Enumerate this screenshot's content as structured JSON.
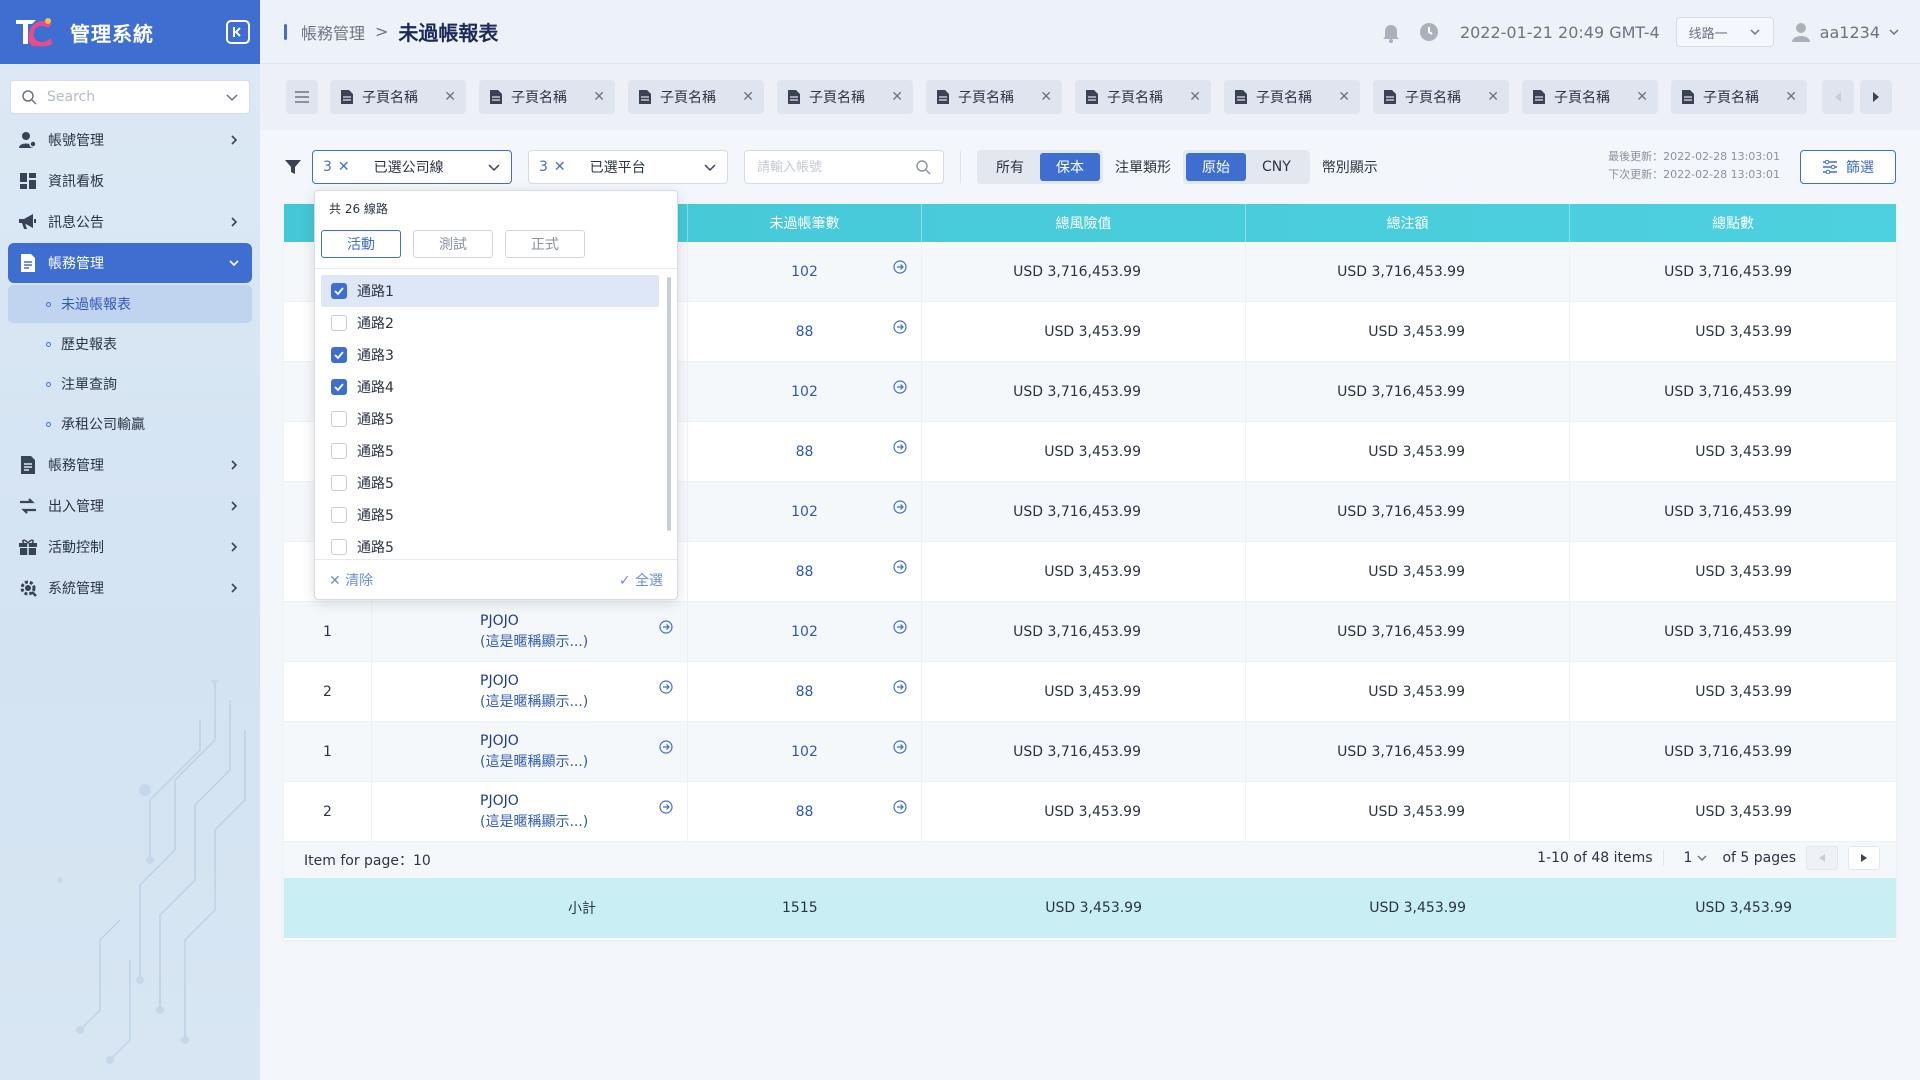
{
  "app": {
    "title": "管理系統"
  },
  "sidebar": {
    "search_placeholder": "Search",
    "items": [
      {
        "label": "帳號管理",
        "icon": "user-gear-icon",
        "has_arrow": true
      },
      {
        "label": "資訊看板",
        "icon": "dashboard-icon",
        "has_arrow": false
      },
      {
        "label": "訊息公告",
        "icon": "megaphone-icon",
        "has_arrow": true
      },
      {
        "label": "帳務管理",
        "icon": "document-icon",
        "has_arrow": true,
        "active": true
      },
      {
        "label": "帳務管理",
        "icon": "report-icon",
        "has_arrow": true
      },
      {
        "label": "出入管理",
        "icon": "transfer-icon",
        "has_arrow": true
      },
      {
        "label": "活動控制",
        "icon": "gift-icon",
        "has_arrow": true
      },
      {
        "label": "系統管理",
        "icon": "settings-icon",
        "has_arrow": true
      }
    ],
    "sub_items": [
      "未過帳報表",
      "歷史報表",
      "注單查詢",
      "承租公司輸贏"
    ]
  },
  "header": {
    "crumb1": "帳務管理",
    "crumb_sep": ">",
    "crumb2": "未過帳報表",
    "datetime": "2022-01-21  20:49  GMT-4",
    "route": "线路一",
    "username": "aa1234"
  },
  "tabs": [
    "子頁名稱",
    "子頁名稱",
    "子頁名稱",
    "子頁名稱",
    "子頁名稱",
    "子頁名稱",
    "子頁名稱",
    "子頁名稱",
    "子頁名稱",
    "子頁名稱"
  ],
  "filters": {
    "company_count": "3",
    "company_label": "已選公司線",
    "platform_count": "3",
    "platform_label": "已選平台",
    "account_placeholder": "請輸入帳號",
    "seg1": [
      "所有",
      "保本"
    ],
    "seg1_active": "保本",
    "seg1_label": "注單類形",
    "seg2": [
      "原始",
      "CNY"
    ],
    "seg2_active": "原始",
    "seg2_label": "幣別顯示",
    "last_update": "最後更新：2022-02-28 13:03:01",
    "next_update": "下次更新：2022-02-28 13:03:01",
    "filter_button": "篩選"
  },
  "table": {
    "headers": [
      "",
      "",
      "未過帳筆數",
      "總風險值",
      "總注額",
      "總點數"
    ],
    "rows": [
      {
        "idx": "",
        "name1": "",
        "name2": "",
        "count": "102",
        "risk": "USD 3,716,453.99",
        "bet": "USD 3,716,453.99",
        "points": "USD 3,716,453.99"
      },
      {
        "idx": "",
        "name1": "",
        "name2": "",
        "count": "88",
        "risk": "USD 3,453.99",
        "bet": "USD 3,453.99",
        "points": "USD 3,453.99"
      },
      {
        "idx": "",
        "name1": "",
        "name2": "",
        "count": "102",
        "risk": "USD 3,716,453.99",
        "bet": "USD 3,716,453.99",
        "points": "USD 3,716,453.99"
      },
      {
        "idx": "",
        "name1": "",
        "name2": "",
        "count": "88",
        "risk": "USD 3,453.99",
        "bet": "USD 3,453.99",
        "points": "USD 3,453.99"
      },
      {
        "idx": "",
        "name1": "",
        "name2": "",
        "count": "102",
        "risk": "USD 3,716,453.99",
        "bet": "USD 3,716,453.99",
        "points": "USD 3,716,453.99"
      },
      {
        "idx": "",
        "name1": "",
        "name2": "",
        "count": "88",
        "risk": "USD 3,453.99",
        "bet": "USD 3,453.99",
        "points": "USD 3,453.99"
      },
      {
        "idx": "1",
        "name1": "PJOJO",
        "name2": "(這是暱稱顯示...)",
        "count": "102",
        "risk": "USD 3,716,453.99",
        "bet": "USD 3,716,453.99",
        "points": "USD 3,716,453.99"
      },
      {
        "idx": "2",
        "name1": "PJOJO",
        "name2": "(這是暱稱顯示...)",
        "count": "88",
        "risk": "USD 3,453.99",
        "bet": "USD 3,453.99",
        "points": "USD 3,453.99"
      },
      {
        "idx": "1",
        "name1": "PJOJO",
        "name2": "(這是暱稱顯示...)",
        "count": "102",
        "risk": "USD 3,716,453.99",
        "bet": "USD 3,716,453.99",
        "points": "USD 3,716,453.99"
      },
      {
        "idx": "2",
        "name1": "PJOJO",
        "name2": "(這是暱稱顯示...)",
        "count": "88",
        "risk": "USD 3,453.99",
        "bet": "USD 3,453.99",
        "points": "USD 3,453.99"
      }
    ],
    "pager": {
      "per_page": "Item for page：10",
      "range": "1-10 of 48 items",
      "page": "1",
      "pages": "of 5 pages"
    },
    "subtotal": {
      "label": "小計",
      "count": "1515",
      "risk": "USD 3,453.99",
      "bet": "USD 3,453.99",
      "points": "USD 3,453.99"
    }
  },
  "dropdown": {
    "total": "共 26 線路",
    "chips": [
      "活動",
      "測試",
      "正式"
    ],
    "chip_active": "活動",
    "items": [
      {
        "label": "通路1",
        "checked": true
      },
      {
        "label": "通路2",
        "checked": false
      },
      {
        "label": "通路3",
        "checked": true
      },
      {
        "label": "通路4",
        "checked": true
      },
      {
        "label": "通路5",
        "checked": false
      },
      {
        "label": "通路5",
        "checked": false
      },
      {
        "label": "通路5",
        "checked": false
      },
      {
        "label": "通路5",
        "checked": false
      },
      {
        "label": "通路5",
        "checked": false
      }
    ],
    "clear": "清除",
    "select_all": "全選"
  },
  "colors": {
    "primary": "#3e6fd0",
    "table_header": "#44c7d6",
    "subtotal_bg": "#c9eef3"
  }
}
